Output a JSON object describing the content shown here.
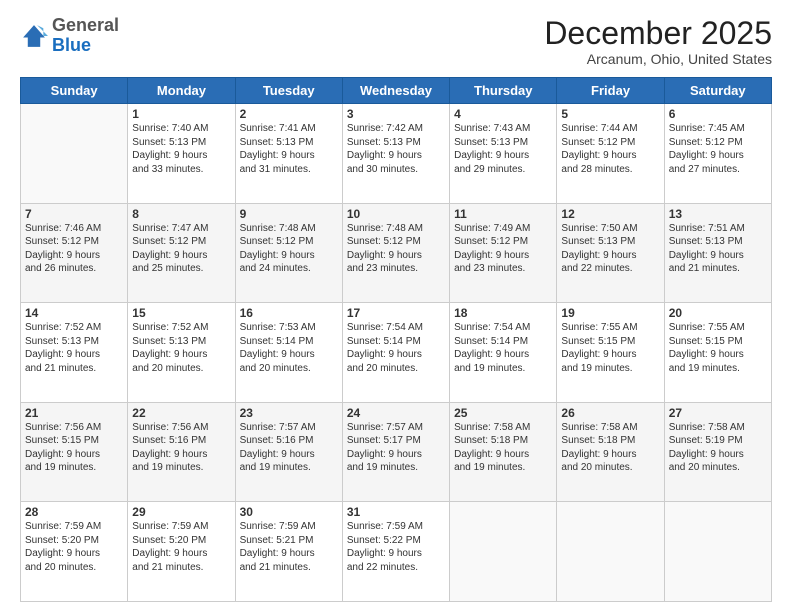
{
  "logo": {
    "general": "General",
    "blue": "Blue"
  },
  "header": {
    "month": "December 2025",
    "location": "Arcanum, Ohio, United States"
  },
  "days_of_week": [
    "Sunday",
    "Monday",
    "Tuesday",
    "Wednesday",
    "Thursday",
    "Friday",
    "Saturday"
  ],
  "weeks": [
    [
      {
        "day": "",
        "info": ""
      },
      {
        "day": "1",
        "info": "Sunrise: 7:40 AM\nSunset: 5:13 PM\nDaylight: 9 hours\nand 33 minutes."
      },
      {
        "day": "2",
        "info": "Sunrise: 7:41 AM\nSunset: 5:13 PM\nDaylight: 9 hours\nand 31 minutes."
      },
      {
        "day": "3",
        "info": "Sunrise: 7:42 AM\nSunset: 5:13 PM\nDaylight: 9 hours\nand 30 minutes."
      },
      {
        "day": "4",
        "info": "Sunrise: 7:43 AM\nSunset: 5:13 PM\nDaylight: 9 hours\nand 29 minutes."
      },
      {
        "day": "5",
        "info": "Sunrise: 7:44 AM\nSunset: 5:12 PM\nDaylight: 9 hours\nand 28 minutes."
      },
      {
        "day": "6",
        "info": "Sunrise: 7:45 AM\nSunset: 5:12 PM\nDaylight: 9 hours\nand 27 minutes."
      }
    ],
    [
      {
        "day": "7",
        "info": "Sunrise: 7:46 AM\nSunset: 5:12 PM\nDaylight: 9 hours\nand 26 minutes."
      },
      {
        "day": "8",
        "info": "Sunrise: 7:47 AM\nSunset: 5:12 PM\nDaylight: 9 hours\nand 25 minutes."
      },
      {
        "day": "9",
        "info": "Sunrise: 7:48 AM\nSunset: 5:12 PM\nDaylight: 9 hours\nand 24 minutes."
      },
      {
        "day": "10",
        "info": "Sunrise: 7:48 AM\nSunset: 5:12 PM\nDaylight: 9 hours\nand 23 minutes."
      },
      {
        "day": "11",
        "info": "Sunrise: 7:49 AM\nSunset: 5:12 PM\nDaylight: 9 hours\nand 23 minutes."
      },
      {
        "day": "12",
        "info": "Sunrise: 7:50 AM\nSunset: 5:13 PM\nDaylight: 9 hours\nand 22 minutes."
      },
      {
        "day": "13",
        "info": "Sunrise: 7:51 AM\nSunset: 5:13 PM\nDaylight: 9 hours\nand 21 minutes."
      }
    ],
    [
      {
        "day": "14",
        "info": "Sunrise: 7:52 AM\nSunset: 5:13 PM\nDaylight: 9 hours\nand 21 minutes."
      },
      {
        "day": "15",
        "info": "Sunrise: 7:52 AM\nSunset: 5:13 PM\nDaylight: 9 hours\nand 20 minutes."
      },
      {
        "day": "16",
        "info": "Sunrise: 7:53 AM\nSunset: 5:14 PM\nDaylight: 9 hours\nand 20 minutes."
      },
      {
        "day": "17",
        "info": "Sunrise: 7:54 AM\nSunset: 5:14 PM\nDaylight: 9 hours\nand 20 minutes."
      },
      {
        "day": "18",
        "info": "Sunrise: 7:54 AM\nSunset: 5:14 PM\nDaylight: 9 hours\nand 19 minutes."
      },
      {
        "day": "19",
        "info": "Sunrise: 7:55 AM\nSunset: 5:15 PM\nDaylight: 9 hours\nand 19 minutes."
      },
      {
        "day": "20",
        "info": "Sunrise: 7:55 AM\nSunset: 5:15 PM\nDaylight: 9 hours\nand 19 minutes."
      }
    ],
    [
      {
        "day": "21",
        "info": "Sunrise: 7:56 AM\nSunset: 5:15 PM\nDaylight: 9 hours\nand 19 minutes."
      },
      {
        "day": "22",
        "info": "Sunrise: 7:56 AM\nSunset: 5:16 PM\nDaylight: 9 hours\nand 19 minutes."
      },
      {
        "day": "23",
        "info": "Sunrise: 7:57 AM\nSunset: 5:16 PM\nDaylight: 9 hours\nand 19 minutes."
      },
      {
        "day": "24",
        "info": "Sunrise: 7:57 AM\nSunset: 5:17 PM\nDaylight: 9 hours\nand 19 minutes."
      },
      {
        "day": "25",
        "info": "Sunrise: 7:58 AM\nSunset: 5:18 PM\nDaylight: 9 hours\nand 19 minutes."
      },
      {
        "day": "26",
        "info": "Sunrise: 7:58 AM\nSunset: 5:18 PM\nDaylight: 9 hours\nand 20 minutes."
      },
      {
        "day": "27",
        "info": "Sunrise: 7:58 AM\nSunset: 5:19 PM\nDaylight: 9 hours\nand 20 minutes."
      }
    ],
    [
      {
        "day": "28",
        "info": "Sunrise: 7:59 AM\nSunset: 5:20 PM\nDaylight: 9 hours\nand 20 minutes."
      },
      {
        "day": "29",
        "info": "Sunrise: 7:59 AM\nSunset: 5:20 PM\nDaylight: 9 hours\nand 21 minutes."
      },
      {
        "day": "30",
        "info": "Sunrise: 7:59 AM\nSunset: 5:21 PM\nDaylight: 9 hours\nand 21 minutes."
      },
      {
        "day": "31",
        "info": "Sunrise: 7:59 AM\nSunset: 5:22 PM\nDaylight: 9 hours\nand 22 minutes."
      },
      {
        "day": "",
        "info": ""
      },
      {
        "day": "",
        "info": ""
      },
      {
        "day": "",
        "info": ""
      }
    ]
  ]
}
